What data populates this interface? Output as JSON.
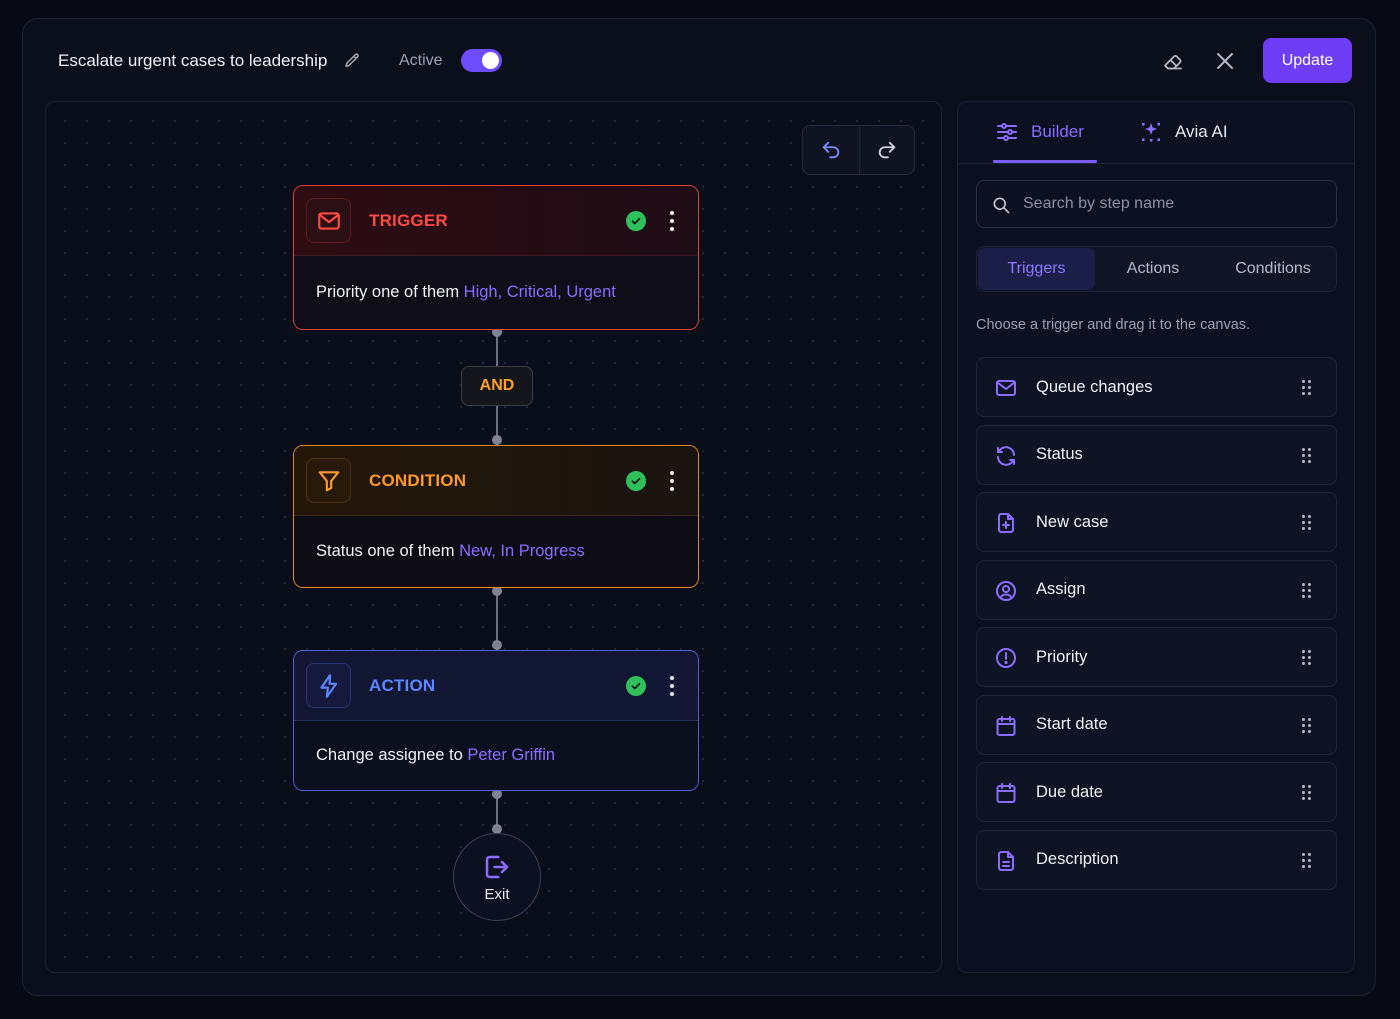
{
  "header": {
    "title": "Escalate urgent cases to leadership",
    "active_label": "Active",
    "active": true,
    "update_label": "Update"
  },
  "flow": {
    "trigger": {
      "title": "TRIGGER",
      "text": "Priority one of them",
      "value": "High, Critical, Urgent",
      "icon": "mail-icon",
      "color": "#ff4a43"
    },
    "operator": "AND",
    "condition": {
      "title": "CONDITION",
      "text": "Status one of them",
      "value": "New, In Progress",
      "icon": "filter-icon",
      "color": "#ff9a2a"
    },
    "action": {
      "title": "ACTION",
      "text": "Change assignee to",
      "value": "Peter Griffin",
      "icon": "lightning-icon",
      "color": "#5b86ff"
    },
    "exit_label": "Exit"
  },
  "panel": {
    "tabs": [
      {
        "label": "Builder",
        "active": true
      },
      {
        "label": "Avia AI",
        "active": false
      }
    ],
    "search_placeholder": "Search by step name",
    "segments": [
      {
        "label": "Triggers",
        "active": true
      },
      {
        "label": "Actions",
        "active": false
      },
      {
        "label": "Conditions",
        "active": false
      }
    ],
    "hint": "Choose a trigger and drag it to the canvas.",
    "items": [
      {
        "label": "Queue changes",
        "icon": "mail-icon"
      },
      {
        "label": "Status",
        "icon": "refresh-icon"
      },
      {
        "label": "New case",
        "icon": "file-plus-icon"
      },
      {
        "label": "Assign",
        "icon": "user-circle-icon"
      },
      {
        "label": "Priority",
        "icon": "alert-circle-icon"
      },
      {
        "label": "Start date",
        "icon": "calendar-icon"
      },
      {
        "label": "Due date",
        "icon": "calendar-icon"
      },
      {
        "label": "Description",
        "icon": "document-icon"
      }
    ]
  },
  "colors": {
    "accent": "#6e3df5",
    "link": "#8b6cff",
    "success": "#2fbf5b"
  }
}
